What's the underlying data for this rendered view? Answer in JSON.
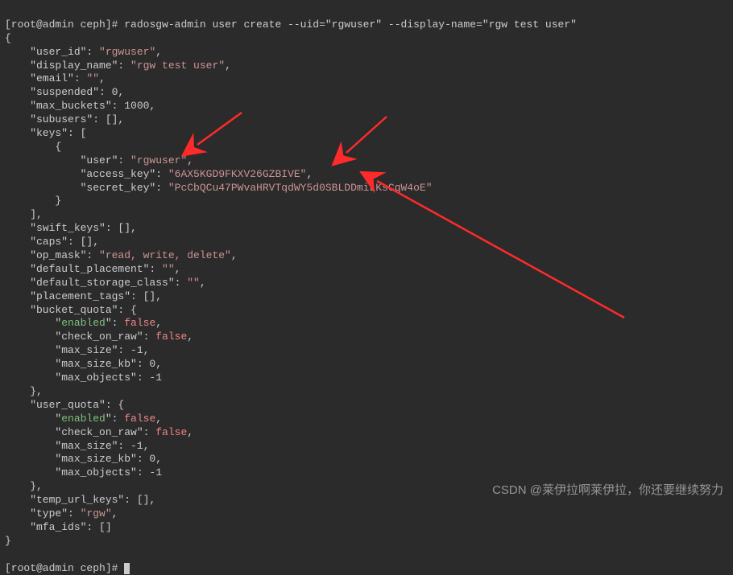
{
  "prompt1_left": "[root@admin ceph]# ",
  "command": "radosgw-admin user create --uid=\"rgwuser\" --display-name=\"rgw test user\"",
  "l_open": "{",
  "l_user_id_k": "    \"user_id\": ",
  "l_user_id_v": "\"rgwuser\"",
  "l_display_k": "    \"display_name\": ",
  "l_display_v": "\"rgw test user\"",
  "l_email_k": "    \"email\": ",
  "l_email_v": "\"\"",
  "l_susp": "    \"suspended\": 0,",
  "l_maxb": "    \"max_buckets\": 1000,",
  "l_subu": "    \"subusers\": [],",
  "l_keys": "    \"keys\": [",
  "l_keys_o": "        {",
  "l_k_user_k": "            \"user\": ",
  "l_k_user_v": "\"rgwuser\"",
  "l_k_ak_k": "            \"access_key\": ",
  "l_k_ak_v": "\"6AX5KGD9FKXV26GZBIVE\"",
  "l_k_sk_k": "            \"secret_key\": ",
  "l_k_sk_v": "\"PcCbQCu47PWvaHRVTqdWY5d0SBLDDmiLKsCqW4oE\"",
  "l_keys_c": "        }",
  "l_keys_e": "    ],",
  "l_swift": "    \"swift_keys\": [],",
  "l_caps": "    \"caps\": [],",
  "l_opm_k": "    \"op_mask\": ",
  "l_opm_v": "\"read, write, delete\"",
  "l_defp_k": "    \"default_placement\": ",
  "l_defp_v": "\"\"",
  "l_defs_k": "    \"default_storage_class\": ",
  "l_defs_v": "\"\"",
  "l_ptags": "    \"placement_tags\": [],",
  "l_bq": "    \"bucket_quota\": {",
  "q_en_k": "        \"",
  "q_en_w": "enabled",
  "q_en_m": "\": ",
  "q_false": "false",
  "q_cor_k": "        \"check_on_raw\": ",
  "q_ms": "        \"max_size\": -1,",
  "q_mskb": "        \"max_size_kb\": 0,",
  "q_mo": "        \"max_objects\": -1",
  "l_close_c": "    },",
  "l_uq": "    \"user_quota\": {",
  "l_temp": "    \"temp_url_keys\": [],",
  "l_type_k": "    \"type\": ",
  "l_type_v": "\"rgw\"",
  "l_mfa": "    \"mfa_ids\": []",
  "l_close": "}",
  "blank": "",
  "prompt2": "[root@admin ceph]# ",
  "comma": ",",
  "watermark": "CSDN @莱伊拉啊莱伊拉，你还要继续努力"
}
